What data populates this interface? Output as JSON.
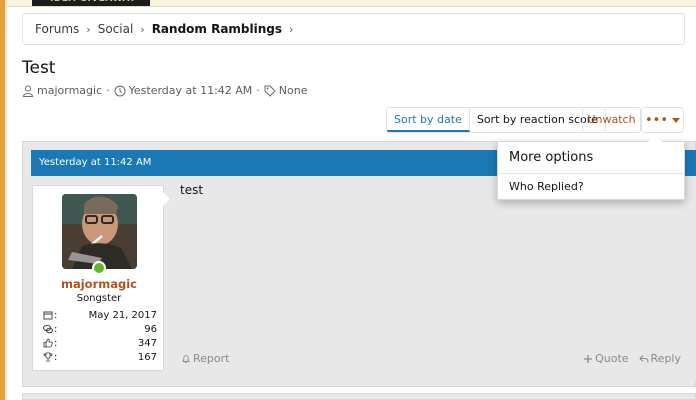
{
  "breadcrumb": {
    "items": [
      "Forums",
      "Social",
      "Random Ramblings"
    ]
  },
  "thread": {
    "title": "Test",
    "author": "majormagic",
    "date": "Yesterday at 11:42 AM",
    "tags": "None"
  },
  "toolbar": {
    "sort_by_date": "Sort by date",
    "sort_by_reaction": "Sort by reaction score",
    "unwatch": "Unwatch",
    "more": "•••"
  },
  "menu": {
    "header": "More options",
    "items": [
      "Who Replied?"
    ]
  },
  "post": {
    "date": "Yesterday at 11:42 AM",
    "content": "test",
    "user": {
      "name": "majormagic",
      "title": "Songster",
      "stats": [
        {
          "icon": "calendar-icon",
          "label": ":",
          "value": "May 21, 2017"
        },
        {
          "icon": "messages-icon",
          "label": ":",
          "value": "96"
        },
        {
          "icon": "thumbs-up-icon",
          "label": ":",
          "value": "347"
        },
        {
          "icon": "trophy-icon",
          "label": ":",
          "value": "167"
        }
      ]
    },
    "actions": {
      "report": "Report",
      "quote": "Quote",
      "reply": "Reply"
    }
  },
  "colors": {
    "accent": "#2577b1",
    "header_bar": "#1a78b4",
    "link": "#b4511f",
    "online": "#63b52a"
  }
}
